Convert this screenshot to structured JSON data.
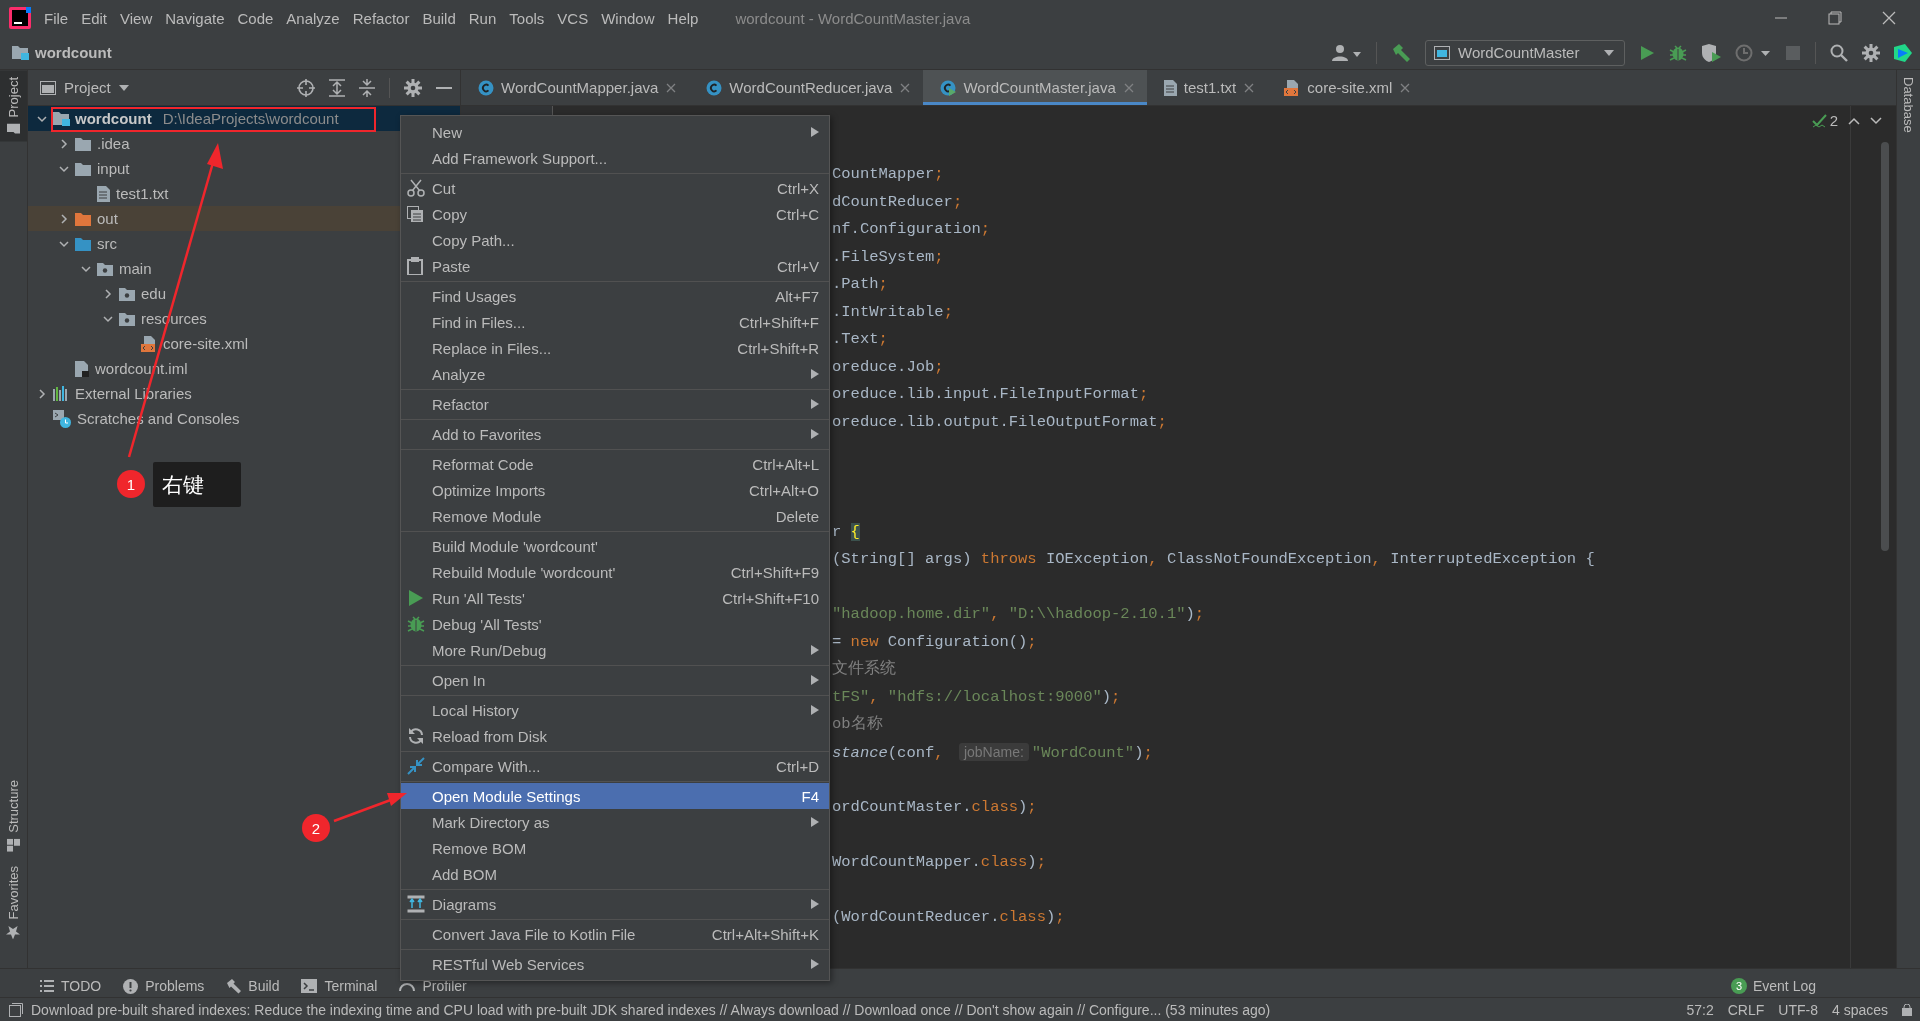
{
  "menu_bar": {
    "items": [
      "File",
      "Edit",
      "View",
      "Navigate",
      "Code",
      "Analyze",
      "Refactor",
      "Build",
      "Run",
      "Tools",
      "VCS",
      "Window",
      "Help"
    ],
    "title": "wordcount - WordCountMaster.java"
  },
  "nav_bar": {
    "breadcrumb": "wordcount",
    "run_config": "WordCountMaster"
  },
  "side_tabs": {
    "left": [
      {
        "label": "Project",
        "selected": true
      },
      {
        "label": "Structure",
        "selected": false
      },
      {
        "label": "Favorites",
        "selected": false
      }
    ],
    "right": [
      {
        "label": "Database",
        "selected": false
      }
    ]
  },
  "project_panel": {
    "title": "Project",
    "tree": [
      {
        "label": "wordcount",
        "path": "D:\\IdeaProjects\\wordcount",
        "kind": "module",
        "expanded": true,
        "selected": true,
        "children": [
          {
            "label": ".idea",
            "kind": "folder",
            "expanded": false,
            "selected": false
          },
          {
            "label": "input",
            "kind": "folder",
            "expanded": true,
            "selected": false,
            "children": [
              {
                "label": "test1.txt",
                "kind": "text",
                "selected": false
              }
            ]
          },
          {
            "label": "out",
            "kind": "excluded",
            "expanded": false,
            "selected": false
          },
          {
            "label": "src",
            "kind": "source",
            "expanded": true,
            "selected": false,
            "children": [
              {
                "label": "main",
                "kind": "package",
                "expanded": true,
                "selected": false,
                "children": [
                  {
                    "label": "edu",
                    "kind": "package",
                    "expanded": false,
                    "selected": false
                  },
                  {
                    "label": "resources",
                    "kind": "package",
                    "expanded": true,
                    "selected": false,
                    "children": [
                      {
                        "label": "core-site.xml",
                        "kind": "xml",
                        "selected": false
                      }
                    ]
                  }
                ]
              }
            ]
          },
          {
            "label": "wordcount.iml",
            "kind": "iml",
            "selected": false
          }
        ]
      },
      {
        "label": "External Libraries",
        "kind": "libraries",
        "expanded": false,
        "selected": false
      },
      {
        "label": "Scratches and Consoles",
        "kind": "scratches",
        "selected": false
      }
    ]
  },
  "editor": {
    "tabs": [
      {
        "label": "WordCountMapper.java",
        "kind": "class",
        "selected": false
      },
      {
        "label": "WordCountReducer.java",
        "kind": "class",
        "selected": false
      },
      {
        "label": "WordCountMaster.java",
        "kind": "main_class",
        "selected": true
      },
      {
        "label": "test1.txt",
        "kind": "text",
        "selected": false
      },
      {
        "label": "core-site.xml",
        "kind": "xml",
        "selected": false
      }
    ],
    "inspection_count": "2",
    "fragments": [
      {
        "kind": "blank"
      },
      {
        "kind": "code",
        "tokens": [
          {
            "kind": "plain",
            "text": "CountMapper"
          },
          {
            "kind": "punct",
            "text": ";"
          }
        ]
      },
      {
        "kind": "code",
        "tokens": [
          {
            "kind": "plain",
            "text": "dCountReducer"
          },
          {
            "kind": "punct",
            "text": ";"
          }
        ]
      },
      {
        "kind": "code",
        "tokens": [
          {
            "kind": "plain",
            "text": "nf.Configuration"
          },
          {
            "kind": "punct",
            "text": ";"
          }
        ]
      },
      {
        "kind": "code",
        "tokens": [
          {
            "kind": "plain",
            "text": ".FileSystem"
          },
          {
            "kind": "punct",
            "text": ";"
          }
        ]
      },
      {
        "kind": "code",
        "tokens": [
          {
            "kind": "plain",
            "text": ".Path"
          },
          {
            "kind": "punct",
            "text": ";"
          }
        ]
      },
      {
        "kind": "code",
        "tokens": [
          {
            "kind": "plain",
            "text": ".IntWritable"
          },
          {
            "kind": "punct",
            "text": ";"
          }
        ]
      },
      {
        "kind": "code",
        "tokens": [
          {
            "kind": "plain",
            "text": ".Text"
          },
          {
            "kind": "punct",
            "text": ";"
          }
        ]
      },
      {
        "kind": "code",
        "tokens": [
          {
            "kind": "plain",
            "text": "oreduce.Job"
          },
          {
            "kind": "punct",
            "text": ";"
          }
        ]
      },
      {
        "kind": "code",
        "tokens": [
          {
            "kind": "plain",
            "text": "oreduce.lib.input.FileInputFormat"
          },
          {
            "kind": "punct",
            "text": ";"
          }
        ]
      },
      {
        "kind": "code",
        "tokens": [
          {
            "kind": "plain",
            "text": "oreduce.lib.output.FileOutputFormat"
          },
          {
            "kind": "punct",
            "text": ";"
          }
        ]
      },
      {
        "kind": "blank"
      },
      {
        "kind": "blank"
      },
      {
        "kind": "blank"
      },
      {
        "kind": "code",
        "tokens": [
          {
            "kind": "plain",
            "text": "r "
          },
          {
            "kind": "brace",
            "text": "{"
          }
        ]
      },
      {
        "kind": "code",
        "tokens": [
          {
            "kind": "plain",
            "text": "(String[] args) "
          },
          {
            "kind": "kw",
            "text": "throws"
          },
          {
            "kind": "plain",
            "text": " IOException"
          },
          {
            "kind": "punct",
            "text": ", "
          },
          {
            "kind": "plain",
            "text": "ClassNotFoundException"
          },
          {
            "kind": "punct",
            "text": ", "
          },
          {
            "kind": "plain",
            "text": "InterruptedException {"
          }
        ]
      },
      {
        "kind": "blank"
      },
      {
        "kind": "code",
        "tokens": [
          {
            "kind": "str",
            "text": "\"hadoop.home.dir\""
          },
          {
            "kind": "punct",
            "text": ", "
          },
          {
            "kind": "str",
            "text": "\"D:\\\\hadoop-2.10.1\""
          },
          {
            "kind": "plain",
            "text": ")"
          },
          {
            "kind": "punct",
            "text": ";"
          }
        ]
      },
      {
        "kind": "code",
        "tokens": [
          {
            "kind": "plain",
            "text": "= "
          },
          {
            "kind": "kw",
            "text": "new"
          },
          {
            "kind": "plain",
            "text": " Configuration()"
          },
          {
            "kind": "punct",
            "text": ";"
          }
        ]
      },
      {
        "kind": "code",
        "tokens": [
          {
            "kind": "comment",
            "text": "文件系统"
          }
        ]
      },
      {
        "kind": "code",
        "tokens": [
          {
            "kind": "str",
            "text": "tFS\""
          },
          {
            "kind": "punct",
            "text": ", "
          },
          {
            "kind": "str",
            "text": "\"hdfs://localhost:9000\""
          },
          {
            "kind": "plain",
            "text": ")"
          },
          {
            "kind": "punct",
            "text": ";"
          }
        ]
      },
      {
        "kind": "code",
        "tokens": [
          {
            "kind": "comment",
            "text": "ob名称"
          }
        ]
      },
      {
        "kind": "code",
        "tokens": [
          {
            "kind": "italic",
            "text": "stance"
          },
          {
            "kind": "plain",
            "text": "(conf"
          },
          {
            "kind": "punct",
            "text": ", "
          },
          {
            "kind": "hint",
            "text": "jobName:"
          },
          {
            "kind": "str",
            "text": "\"WordCount\""
          },
          {
            "kind": "plain",
            "text": ")"
          },
          {
            "kind": "punct",
            "text": ";"
          }
        ]
      },
      {
        "kind": "blank"
      },
      {
        "kind": "code",
        "tokens": [
          {
            "kind": "plain",
            "text": "ordCountMaster."
          },
          {
            "kind": "kw",
            "text": "class"
          },
          {
            "kind": "plain",
            "text": ")"
          },
          {
            "kind": "punct",
            "text": ";"
          }
        ]
      },
      {
        "kind": "blank"
      },
      {
        "kind": "code",
        "tokens": [
          {
            "kind": "plain",
            "text": "WordCountMapper."
          },
          {
            "kind": "kw",
            "text": "class"
          },
          {
            "kind": "plain",
            "text": ")"
          },
          {
            "kind": "punct",
            "text": ";"
          }
        ]
      },
      {
        "kind": "blank"
      },
      {
        "kind": "code",
        "tokens": [
          {
            "kind": "plain",
            "text": "(WordCountReducer."
          },
          {
            "kind": "kw",
            "text": "class"
          },
          {
            "kind": "plain",
            "text": ")"
          },
          {
            "kind": "punct",
            "text": ";"
          }
        ]
      }
    ]
  },
  "context_menu": {
    "items": [
      {
        "kind": "item",
        "label": "New",
        "submenu": true,
        "selected": false
      },
      {
        "kind": "item",
        "label": "Add Framework Support...",
        "selected": false
      },
      {
        "kind": "separator"
      },
      {
        "kind": "item",
        "label": "Cut",
        "shortcut": "Ctrl+X",
        "selected": false
      },
      {
        "kind": "item",
        "label": "Copy",
        "shortcut": "Ctrl+C",
        "selected": false
      },
      {
        "kind": "item",
        "label": "Copy Path...",
        "selected": false
      },
      {
        "kind": "item",
        "label": "Paste",
        "shortcut": "Ctrl+V",
        "selected": false
      },
      {
        "kind": "separator"
      },
      {
        "kind": "item",
        "label": "Find Usages",
        "shortcut": "Alt+F7",
        "selected": false
      },
      {
        "kind": "item",
        "label": "Find in Files...",
        "shortcut": "Ctrl+Shift+F",
        "selected": false
      },
      {
        "kind": "item",
        "label": "Replace in Files...",
        "shortcut": "Ctrl+Shift+R",
        "selected": false
      },
      {
        "kind": "item",
        "label": "Analyze",
        "submenu": true,
        "selected": false
      },
      {
        "kind": "separator"
      },
      {
        "kind": "item",
        "label": "Refactor",
        "submenu": true,
        "selected": false
      },
      {
        "kind": "separator"
      },
      {
        "kind": "item",
        "label": "Add to Favorites",
        "submenu": true,
        "selected": false
      },
      {
        "kind": "separator"
      },
      {
        "kind": "item",
        "label": "Reformat Code",
        "shortcut": "Ctrl+Alt+L",
        "selected": false
      },
      {
        "kind": "item",
        "label": "Optimize Imports",
        "shortcut": "Ctrl+Alt+O",
        "selected": false
      },
      {
        "kind": "item",
        "label": "Remove Module",
        "shortcut": "Delete",
        "selected": false
      },
      {
        "kind": "separator"
      },
      {
        "kind": "item",
        "label": "Build Module 'wordcount'",
        "selected": false
      },
      {
        "kind": "item",
        "label": "Rebuild Module 'wordcount'",
        "shortcut": "Ctrl+Shift+F9",
        "selected": false
      },
      {
        "kind": "item",
        "label": "Run 'All Tests'",
        "shortcut": "Ctrl+Shift+F10",
        "selected": false
      },
      {
        "kind": "item",
        "label": "Debug 'All Tests'",
        "selected": false
      },
      {
        "kind": "item",
        "label": "More Run/Debug",
        "submenu": true,
        "selected": false
      },
      {
        "kind": "separator"
      },
      {
        "kind": "item",
        "label": "Open In",
        "submenu": true,
        "selected": false
      },
      {
        "kind": "separator"
      },
      {
        "kind": "item",
        "label": "Local History",
        "submenu": true,
        "selected": false
      },
      {
        "kind": "item",
        "label": "Reload from Disk",
        "selected": false
      },
      {
        "kind": "separator"
      },
      {
        "kind": "item",
        "label": "Compare With...",
        "shortcut": "Ctrl+D",
        "selected": false
      },
      {
        "kind": "separator"
      },
      {
        "kind": "item",
        "label": "Open Module Settings",
        "shortcut": "F4",
        "selected": true
      },
      {
        "kind": "item",
        "label": "Mark Directory as",
        "submenu": true,
        "selected": false
      },
      {
        "kind": "item",
        "label": "Remove BOM",
        "selected": false
      },
      {
        "kind": "item",
        "label": "Add BOM",
        "selected": false
      },
      {
        "kind": "separator"
      },
      {
        "kind": "item",
        "label": "Diagrams",
        "submenu": true,
        "selected": false
      },
      {
        "kind": "separator"
      },
      {
        "kind": "item",
        "label": "Convert Java File to Kotlin File",
        "shortcut": "Ctrl+Alt+Shift+K",
        "selected": false
      },
      {
        "kind": "separator"
      },
      {
        "kind": "item",
        "label": "RESTful Web Services",
        "submenu": true,
        "selected": false
      }
    ]
  },
  "annotations": [
    {
      "number": "1",
      "label": "右键"
    },
    {
      "number": "2"
    }
  ],
  "bottom_bar": {
    "tools": [
      {
        "label": "TODO",
        "kind": "todo"
      },
      {
        "label": "Problems",
        "kind": "problems"
      },
      {
        "label": "Build",
        "kind": "build"
      },
      {
        "label": "Terminal",
        "kind": "terminal"
      },
      {
        "label": "Profiler",
        "kind": "profiler"
      }
    ],
    "event_log": {
      "label": "Event Log",
      "count": "3"
    }
  },
  "status_bar": {
    "message": "Download pre-built shared indexes: Reduce the indexing time and CPU load with pre-built JDK shared indexes // Always download // Download once // Don't show again // Configure... (53 minutes ago)",
    "position": "57:2",
    "line_separator": "CRLF",
    "encoding": "UTF-8",
    "indent": "4 spaces"
  }
}
